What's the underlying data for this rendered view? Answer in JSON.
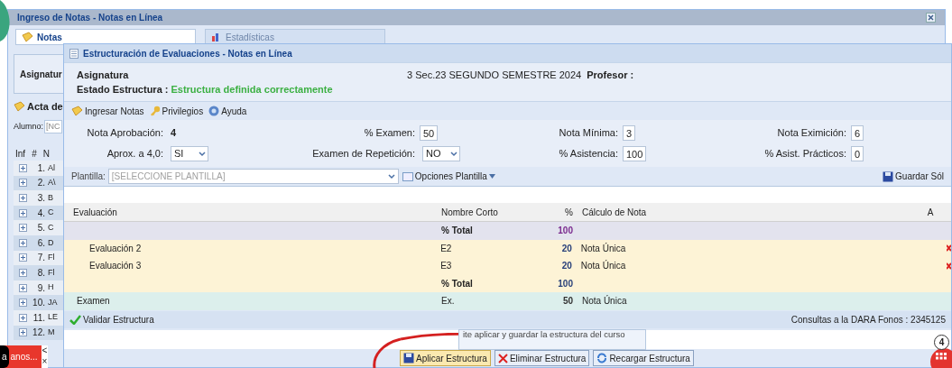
{
  "window": {
    "title": "Ingreso de Notas - Notas en Línea"
  },
  "tabs": [
    {
      "label": "Notas",
      "selected": true
    },
    {
      "label": "Estadísticas",
      "selected": false
    }
  ],
  "background": {
    "subject_label": "Asignatur",
    "section_title": "Acta de",
    "student_label": "Alumno:",
    "student_value": "[NC",
    "columns": [
      "Inf",
      "#",
      "N"
    ],
    "rows": [
      {
        "number": "1.",
        "name": "Al"
      },
      {
        "number": "2.",
        "name": "A\\"
      },
      {
        "number": "3.",
        "name": "B"
      },
      {
        "number": "4.",
        "name": "C"
      },
      {
        "number": "5.",
        "name": "C"
      },
      {
        "number": "6.",
        "name": "D"
      },
      {
        "number": "7.",
        "name": "Fl"
      },
      {
        "number": "8.",
        "name": "Fl"
      },
      {
        "number": "9.",
        "name": "H"
      },
      {
        "number": "10.",
        "name": "JA"
      },
      {
        "number": "11.",
        "name": "LE"
      },
      {
        "number": "12.",
        "name": "M"
      }
    ]
  },
  "dialog": {
    "title": "Estructuración de Evaluaciones - Notas en Línea",
    "subject_label": "Asignatura",
    "term": "3 Sec.23 SEGUNDO SEMESTRE 2024",
    "teacher_label": "Profesor :",
    "status_label": "Estado Estructura :",
    "status": "Estructura definida correctamente",
    "toolbar": [
      {
        "label": "Ingresar Notas",
        "kind": "notes"
      },
      {
        "label": "Privilegios",
        "kind": "key"
      },
      {
        "label": "Ayuda",
        "kind": "help"
      }
    ],
    "form": [
      [
        {
          "label": "Nota Aprobación:",
          "kind": "value",
          "value": "4"
        },
        {
          "label": "% Examen:",
          "kind": "input",
          "value": "50"
        },
        {
          "label": "Nota Mínima:",
          "kind": "input",
          "value": "3"
        },
        {
          "label": "Nota Eximición:",
          "kind": "input",
          "value": "6"
        }
      ],
      [
        {
          "label": "Aprox. a 4,0:",
          "kind": "select",
          "value": "SI"
        },
        {
          "label": "Examen de Repetición:",
          "kind": "select",
          "value": "NO"
        },
        {
          "label": "% Asistencia:",
          "kind": "input",
          "value": "100"
        },
        {
          "label": "% Asist. Prácticos:",
          "kind": "input",
          "value": "0"
        }
      ]
    ],
    "template": {
      "label": "Plantilla:",
      "placeholder": "[SELECCIONE PLANTILLA]",
      "options_button": "Opciones Plantilla",
      "save_button": "Guardar Sól"
    },
    "table": {
      "columns": [
        "Evaluación",
        "Nombre Corto",
        "%",
        "Cálculo de Nota",
        "A"
      ],
      "rows": [
        {
          "kind": "total",
          "short_name": "% Total",
          "percent": "100",
          "deletable": false
        },
        {
          "kind": "evaluation",
          "evaluation": "Evaluación 2",
          "short_name": "E2",
          "percent": "20",
          "calculation": "Nota Única",
          "deletable": true
        },
        {
          "kind": "evaluation",
          "evaluation": "Evaluación 3",
          "short_name": "E3",
          "percent": "20",
          "calculation": "Nota Única",
          "deletable": true
        },
        {
          "kind": "subtotal",
          "short_name": "% Total",
          "percent": "100",
          "deletable": false
        },
        {
          "kind": "exam",
          "evaluation": "Examen",
          "short_name": "Ex.",
          "percent": "50",
          "calculation": "Nota Única",
          "deletable": false
        }
      ]
    },
    "footer": {
      "validate": "Validar Estructura",
      "contact": "Consultas a la DARA Fonos : 2345125"
    },
    "tooltip": "ite aplicar y guardar la estructura del curso",
    "buttons": [
      {
        "label": "Aplicar Estructura",
        "kind": "apply",
        "focused": true
      },
      {
        "label": "Eliminar Estructura",
        "kind": "delete",
        "focused": false
      },
      {
        "label": "Recargar Estructura",
        "kind": "reload",
        "focused": false
      }
    ]
  },
  "notification": {
    "badge": "a",
    "text": "anos...",
    "actions": [
      "<",
      "×"
    ]
  },
  "fab": {
    "count": "4"
  }
}
